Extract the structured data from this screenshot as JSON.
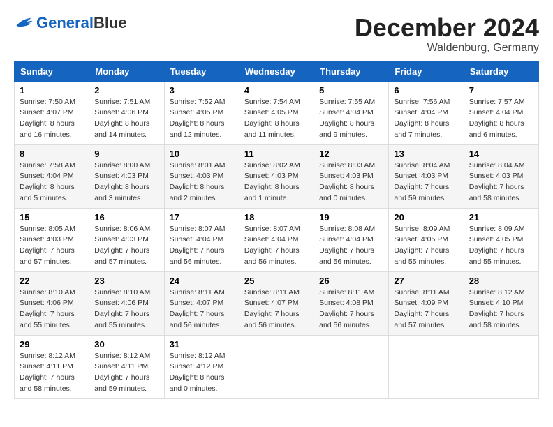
{
  "header": {
    "logo_general": "General",
    "logo_blue": "Blue",
    "month_title": "December 2024",
    "location": "Waldenburg, Germany"
  },
  "days_of_week": [
    "Sunday",
    "Monday",
    "Tuesday",
    "Wednesday",
    "Thursday",
    "Friday",
    "Saturday"
  ],
  "weeks": [
    [
      {
        "day": "1",
        "sunrise": "7:50 AM",
        "sunset": "4:07 PM",
        "daylight": "8 hours and 16 minutes."
      },
      {
        "day": "2",
        "sunrise": "7:51 AM",
        "sunset": "4:06 PM",
        "daylight": "8 hours and 14 minutes."
      },
      {
        "day": "3",
        "sunrise": "7:52 AM",
        "sunset": "4:05 PM",
        "daylight": "8 hours and 12 minutes."
      },
      {
        "day": "4",
        "sunrise": "7:54 AM",
        "sunset": "4:05 PM",
        "daylight": "8 hours and 11 minutes."
      },
      {
        "day": "5",
        "sunrise": "7:55 AM",
        "sunset": "4:04 PM",
        "daylight": "8 hours and 9 minutes."
      },
      {
        "day": "6",
        "sunrise": "7:56 AM",
        "sunset": "4:04 PM",
        "daylight": "8 hours and 7 minutes."
      },
      {
        "day": "7",
        "sunrise": "7:57 AM",
        "sunset": "4:04 PM",
        "daylight": "8 hours and 6 minutes."
      }
    ],
    [
      {
        "day": "8",
        "sunrise": "7:58 AM",
        "sunset": "4:04 PM",
        "daylight": "8 hours and 5 minutes."
      },
      {
        "day": "9",
        "sunrise": "8:00 AM",
        "sunset": "4:03 PM",
        "daylight": "8 hours and 3 minutes."
      },
      {
        "day": "10",
        "sunrise": "8:01 AM",
        "sunset": "4:03 PM",
        "daylight": "8 hours and 2 minutes."
      },
      {
        "day": "11",
        "sunrise": "8:02 AM",
        "sunset": "4:03 PM",
        "daylight": "8 hours and 1 minute."
      },
      {
        "day": "12",
        "sunrise": "8:03 AM",
        "sunset": "4:03 PM",
        "daylight": "8 hours and 0 minutes."
      },
      {
        "day": "13",
        "sunrise": "8:04 AM",
        "sunset": "4:03 PM",
        "daylight": "7 hours and 59 minutes."
      },
      {
        "day": "14",
        "sunrise": "8:04 AM",
        "sunset": "4:03 PM",
        "daylight": "7 hours and 58 minutes."
      }
    ],
    [
      {
        "day": "15",
        "sunrise": "8:05 AM",
        "sunset": "4:03 PM",
        "daylight": "7 hours and 57 minutes."
      },
      {
        "day": "16",
        "sunrise": "8:06 AM",
        "sunset": "4:03 PM",
        "daylight": "7 hours and 57 minutes."
      },
      {
        "day": "17",
        "sunrise": "8:07 AM",
        "sunset": "4:04 PM",
        "daylight": "7 hours and 56 minutes."
      },
      {
        "day": "18",
        "sunrise": "8:07 AM",
        "sunset": "4:04 PM",
        "daylight": "7 hours and 56 minutes."
      },
      {
        "day": "19",
        "sunrise": "8:08 AM",
        "sunset": "4:04 PM",
        "daylight": "7 hours and 56 minutes."
      },
      {
        "day": "20",
        "sunrise": "8:09 AM",
        "sunset": "4:05 PM",
        "daylight": "7 hours and 55 minutes."
      },
      {
        "day": "21",
        "sunrise": "8:09 AM",
        "sunset": "4:05 PM",
        "daylight": "7 hours and 55 minutes."
      }
    ],
    [
      {
        "day": "22",
        "sunrise": "8:10 AM",
        "sunset": "4:06 PM",
        "daylight": "7 hours and 55 minutes."
      },
      {
        "day": "23",
        "sunrise": "8:10 AM",
        "sunset": "4:06 PM",
        "daylight": "7 hours and 55 minutes."
      },
      {
        "day": "24",
        "sunrise": "8:11 AM",
        "sunset": "4:07 PM",
        "daylight": "7 hours and 56 minutes."
      },
      {
        "day": "25",
        "sunrise": "8:11 AM",
        "sunset": "4:07 PM",
        "daylight": "7 hours and 56 minutes."
      },
      {
        "day": "26",
        "sunrise": "8:11 AM",
        "sunset": "4:08 PM",
        "daylight": "7 hours and 56 minutes."
      },
      {
        "day": "27",
        "sunrise": "8:11 AM",
        "sunset": "4:09 PM",
        "daylight": "7 hours and 57 minutes."
      },
      {
        "day": "28",
        "sunrise": "8:12 AM",
        "sunset": "4:10 PM",
        "daylight": "7 hours and 58 minutes."
      }
    ],
    [
      {
        "day": "29",
        "sunrise": "8:12 AM",
        "sunset": "4:11 PM",
        "daylight": "7 hours and 58 minutes."
      },
      {
        "day": "30",
        "sunrise": "8:12 AM",
        "sunset": "4:11 PM",
        "daylight": "7 hours and 59 minutes."
      },
      {
        "day": "31",
        "sunrise": "8:12 AM",
        "sunset": "4:12 PM",
        "daylight": "8 hours and 0 minutes."
      },
      null,
      null,
      null,
      null
    ]
  ]
}
